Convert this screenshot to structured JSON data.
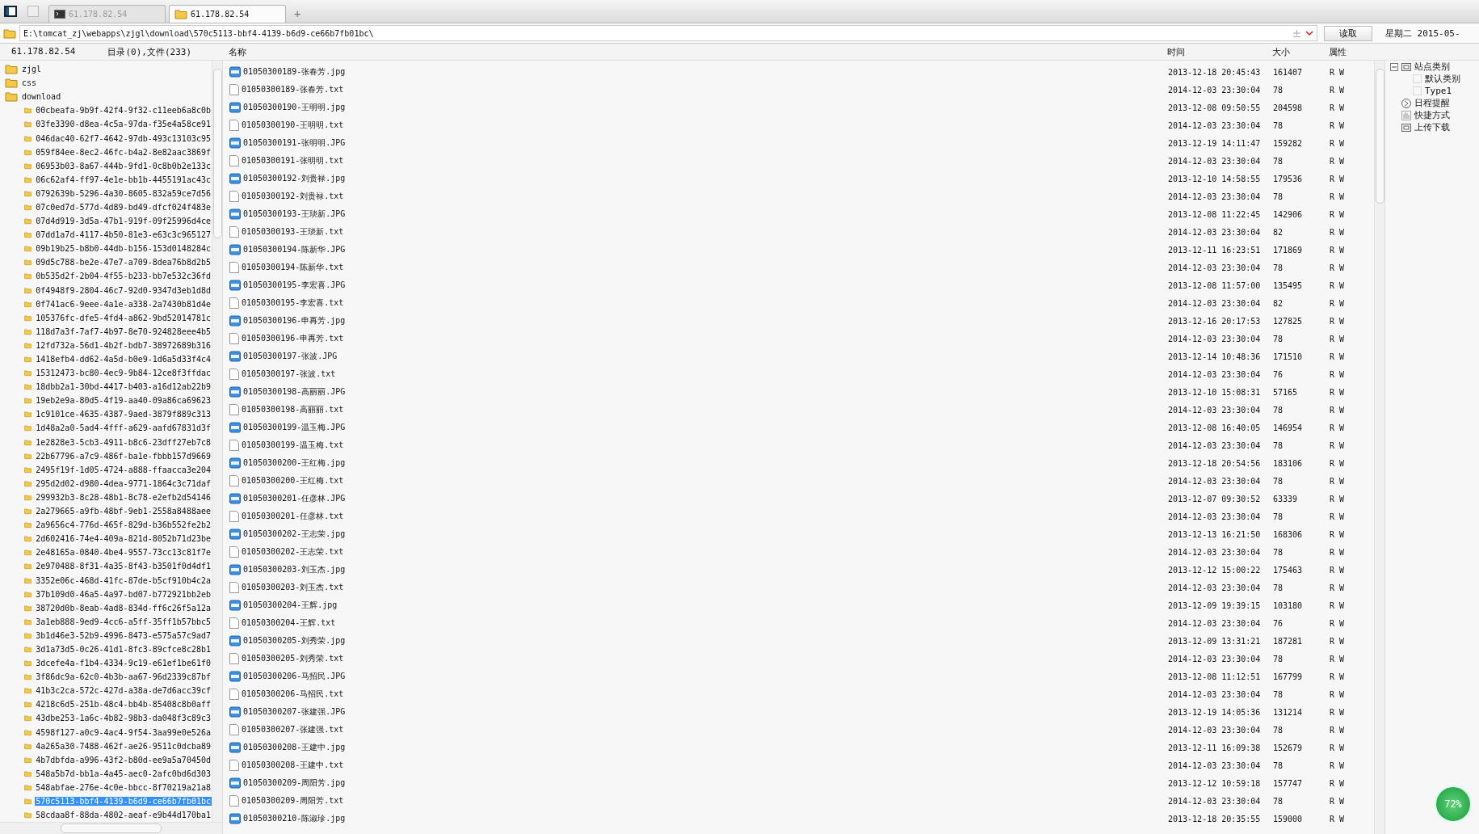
{
  "tabs": [
    {
      "label": "61.178.82.54",
      "kind": "terminal",
      "selected": false
    },
    {
      "label": "61.178.82.54",
      "kind": "folder",
      "selected": true
    }
  ],
  "new_tab": "+",
  "address": {
    "value": "E:\\tomcat_zj\\webapps\\zjgl\\download\\570c5113-bbf4-4139-b6d9-ce66b7fb01bc\\",
    "read_button": "读取",
    "date": "星期二 2015-05-"
  },
  "left_header": {
    "host": "61.178.82.54",
    "summary": "目录(0),文件(233)"
  },
  "tree": [
    {
      "label": "zjgl",
      "selected": false
    },
    {
      "label": "css",
      "selected": false
    },
    {
      "label": "download",
      "selected": false,
      "children": [
        {
          "label": "00cbeafa-9b9f-42f4-9f32-c11eeb6a8c0b",
          "selected": false
        },
        {
          "label": "03fe3390-d8ea-4c5a-97da-f35e4a58ce91",
          "selected": false
        },
        {
          "label": "046dac40-62f7-4642-97db-493c13103c95",
          "selected": false
        },
        {
          "label": "059f84ee-8ec2-46fc-b4a2-8e82aac3869f",
          "selected": false
        },
        {
          "label": "06953b03-8a67-444b-9fd1-0c8b0b2e133c",
          "selected": false
        },
        {
          "label": "06c62af4-ff97-4e1e-bb1b-4455191ac43c",
          "selected": false
        },
        {
          "label": "0792639b-5296-4a30-8605-832a59ce7d56",
          "selected": false
        },
        {
          "label": "07c0ed7d-577d-4d89-bd49-dfcf024f483e",
          "selected": false
        },
        {
          "label": "07d4d919-3d5a-47b1-919f-09f25996d4ce",
          "selected": false
        },
        {
          "label": "07dd1a7d-4117-4b50-81e3-e63c3c965127",
          "selected": false
        },
        {
          "label": "09b19b25-b8b0-44db-b156-153d0148284c",
          "selected": false
        },
        {
          "label": "09d5c788-be2e-47e7-a709-8dea76b8d2b5",
          "selected": false
        },
        {
          "label": "0b535d2f-2b04-4f55-b233-bb7e532c36fd",
          "selected": false
        },
        {
          "label": "0f4948f9-2804-46c7-92d0-9347d3eb1d8d",
          "selected": false
        },
        {
          "label": "0f741ac6-9eee-4a1e-a338-2a7430b81d4e",
          "selected": false
        },
        {
          "label": "105376fc-dfe5-4fd4-a862-9bd52014781c",
          "selected": false
        },
        {
          "label": "118d7a3f-7af7-4b97-8e70-924828eee4b5",
          "selected": false
        },
        {
          "label": "12fd732a-56d1-4b2f-bdb7-38972689b316",
          "selected": false
        },
        {
          "label": "1418efb4-dd62-4a5d-b0e9-1d6a5d33f4c4",
          "selected": false
        },
        {
          "label": "15312473-bc80-4ec9-9b84-12ce8f3ffdac",
          "selected": false
        },
        {
          "label": "18dbb2a1-30bd-4417-b403-a16d12ab22b9",
          "selected": false
        },
        {
          "label": "19eb2e9a-80d5-4f19-aa40-09a86ca69623",
          "selected": false
        },
        {
          "label": "1c9101ce-4635-4387-9aed-3879f889c313",
          "selected": false
        },
        {
          "label": "1d48a2a0-5ad4-4fff-a629-aafd67831d3f",
          "selected": false
        },
        {
          "label": "1e2828e3-5cb3-4911-b8c6-23dff27eb7c8",
          "selected": false
        },
        {
          "label": "22b67796-a7c9-486f-ba1e-fbbb157d9669",
          "selected": false
        },
        {
          "label": "2495f19f-1d05-4724-a888-ffaacca3e204",
          "selected": false
        },
        {
          "label": "295d2d02-d980-4dea-9771-1864c3c71daf",
          "selected": false
        },
        {
          "label": "299932b3-8c28-48b1-8c78-e2efb2d54146",
          "selected": false
        },
        {
          "label": "2a279665-a9fb-48bf-9eb1-2558a8488aee",
          "selected": false
        },
        {
          "label": "2a9656c4-776d-465f-829d-b36b552fe2b2",
          "selected": false
        },
        {
          "label": "2d602416-74e4-409a-821d-8052b71d23be",
          "selected": false
        },
        {
          "label": "2e48165a-0840-4be4-9557-73cc13c81f7e",
          "selected": false
        },
        {
          "label": "2e970488-8f31-4a35-8f43-b3501f0d4df1",
          "selected": false
        },
        {
          "label": "3352e06c-468d-41fc-87de-b5cf910b4c2a",
          "selected": false
        },
        {
          "label": "37b109d0-46a5-4a97-bd07-b772921bb2eb",
          "selected": false
        },
        {
          "label": "38720d0b-8eab-4ad8-834d-ff6c26f5a12a",
          "selected": false
        },
        {
          "label": "3a1eb888-9ed9-4cc6-a5ff-35ff1b57bbc5",
          "selected": false
        },
        {
          "label": "3b1d46e3-52b9-4996-8473-e575a57c9ad7",
          "selected": false
        },
        {
          "label": "3d1a73d5-0c26-41d1-8fc3-89cfce8c28b1",
          "selected": false
        },
        {
          "label": "3dcefe4a-f1b4-4334-9c19-e61ef1be61f0",
          "selected": false
        },
        {
          "label": "3f86dc9a-62c0-4b3b-aa67-96d2339c87bf",
          "selected": false
        },
        {
          "label": "41b3c2ca-572c-427d-a38a-de7d6acc39cf",
          "selected": false
        },
        {
          "label": "4218c6d5-251b-48c4-bb4b-85408c8b0aff",
          "selected": false
        },
        {
          "label": "43dbe253-1a6c-4b82-98b3-da048f3c89c3",
          "selected": false
        },
        {
          "label": "4598f127-a0c9-4ac4-9f54-3aa99e0e526a",
          "selected": false
        },
        {
          "label": "4a265a30-7488-462f-ae26-9511c0dcba89",
          "selected": false
        },
        {
          "label": "4b7dbfda-a996-43f2-b80d-ee9a5a70450d",
          "selected": false
        },
        {
          "label": "548a5b7d-bb1a-4a45-aec0-2afc0bd6d303",
          "selected": false
        },
        {
          "label": "548abfae-276e-4c0e-bbcc-8f70219a21a8",
          "selected": false
        },
        {
          "label": "570c5113-bbf4-4139-b6d9-ce66b7fb01bc",
          "selected": true
        },
        {
          "label": "58cdaa8f-88da-4802-aeaf-e9b44d170ba1",
          "selected": false
        }
      ]
    }
  ],
  "columns": [
    "名称",
    "时间",
    "大小",
    "属性"
  ],
  "files": [
    {
      "kind": "jpg",
      "name": "01050300189-张春芳.jpg",
      "time": "2013-12-18 20:45:43",
      "size": "161407",
      "attr": "R W"
    },
    {
      "kind": "txt",
      "name": "01050300189-张春芳.txt",
      "time": "2014-12-03 23:30:04",
      "size": "78",
      "attr": "R W"
    },
    {
      "kind": "jpg",
      "name": "01050300190-王明明.jpg",
      "time": "2013-12-08 09:50:55",
      "size": "204598",
      "attr": "R W"
    },
    {
      "kind": "txt",
      "name": "01050300190-王明明.txt",
      "time": "2014-12-03 23:30:04",
      "size": "78",
      "attr": "R W"
    },
    {
      "kind": "jpg",
      "name": "01050300191-张明明.JPG",
      "time": "2013-12-19 14:11:47",
      "size": "159282",
      "attr": "R W"
    },
    {
      "kind": "txt",
      "name": "01050300191-张明明.txt",
      "time": "2014-12-03 23:30:04",
      "size": "78",
      "attr": "R W"
    },
    {
      "kind": "jpg",
      "name": "01050300192-刘贵禄.jpg",
      "time": "2013-12-10 14:58:55",
      "size": "179536",
      "attr": "R W"
    },
    {
      "kind": "txt",
      "name": "01050300192-刘贵禄.txt",
      "time": "2014-12-03 23:30:04",
      "size": "78",
      "attr": "R W"
    },
    {
      "kind": "jpg",
      "name": "01050300193-王琰新.JPG",
      "time": "2013-12-08 11:22:45",
      "size": "142906",
      "attr": "R W"
    },
    {
      "kind": "txt",
      "name": "01050300193-王琰新.txt",
      "time": "2014-12-03 23:30:04",
      "size": "82",
      "attr": "R W"
    },
    {
      "kind": "jpg",
      "name": "01050300194-陈新华.JPG",
      "time": "2013-12-11 16:23:51",
      "size": "171869",
      "attr": "R W"
    },
    {
      "kind": "txt",
      "name": "01050300194-陈新华.txt",
      "time": "2014-12-03 23:30:04",
      "size": "78",
      "attr": "R W"
    },
    {
      "kind": "jpg",
      "name": "01050300195-李宏喜.JPG",
      "time": "2013-12-08 11:57:00",
      "size": "135495",
      "attr": "R W"
    },
    {
      "kind": "txt",
      "name": "01050300195-李宏喜.txt",
      "time": "2014-12-03 23:30:04",
      "size": "82",
      "attr": "R W"
    },
    {
      "kind": "jpg",
      "name": "01050300196-申再芳.jpg",
      "time": "2013-12-16 20:17:53",
      "size": "127825",
      "attr": "R W"
    },
    {
      "kind": "txt",
      "name": "01050300196-申再芳.txt",
      "time": "2014-12-03 23:30:04",
      "size": "78",
      "attr": "R W"
    },
    {
      "kind": "jpg",
      "name": "01050300197-张波.JPG",
      "time": "2013-12-14 10:48:36",
      "size": "171510",
      "attr": "R W"
    },
    {
      "kind": "txt",
      "name": "01050300197-张波.txt",
      "time": "2014-12-03 23:30:04",
      "size": "76",
      "attr": "R W"
    },
    {
      "kind": "jpg",
      "name": "01050300198-高丽丽.JPG",
      "time": "2013-12-10 15:08:31",
      "size": "57165",
      "attr": "R W"
    },
    {
      "kind": "txt",
      "name": "01050300198-高丽丽.txt",
      "time": "2014-12-03 23:30:04",
      "size": "78",
      "attr": "R W"
    },
    {
      "kind": "jpg",
      "name": "01050300199-温玉梅.JPG",
      "time": "2013-12-08 16:40:05",
      "size": "146954",
      "attr": "R W"
    },
    {
      "kind": "txt",
      "name": "01050300199-温玉梅.txt",
      "time": "2014-12-03 23:30:04",
      "size": "78",
      "attr": "R W"
    },
    {
      "kind": "jpg",
      "name": "01050300200-王红梅.jpg",
      "time": "2013-12-18 20:54:56",
      "size": "183106",
      "attr": "R W"
    },
    {
      "kind": "txt",
      "name": "01050300200-王红梅.txt",
      "time": "2014-12-03 23:30:04",
      "size": "78",
      "attr": "R W"
    },
    {
      "kind": "jpg",
      "name": "01050300201-任彦林.JPG",
      "time": "2013-12-07 09:30:52",
      "size": "63339",
      "attr": "R W"
    },
    {
      "kind": "txt",
      "name": "01050300201-任彦林.txt",
      "time": "2014-12-03 23:30:04",
      "size": "78",
      "attr": "R W"
    },
    {
      "kind": "jpg",
      "name": "01050300202-王志荣.jpg",
      "time": "2013-12-13 16:21:50",
      "size": "168306",
      "attr": "R W"
    },
    {
      "kind": "txt",
      "name": "01050300202-王志荣.txt",
      "time": "2014-12-03 23:30:04",
      "size": "78",
      "attr": "R W"
    },
    {
      "kind": "jpg",
      "name": "01050300203-刘玉杰.jpg",
      "time": "2013-12-12 15:00:22",
      "size": "175463",
      "attr": "R W"
    },
    {
      "kind": "txt",
      "name": "01050300203-刘玉杰.txt",
      "time": "2014-12-03 23:30:04",
      "size": "78",
      "attr": "R W"
    },
    {
      "kind": "jpg",
      "name": "01050300204-王辉.jpg",
      "time": "2013-12-09 19:39:15",
      "size": "103180",
      "attr": "R W"
    },
    {
      "kind": "txt",
      "name": "01050300204-王辉.txt",
      "time": "2014-12-03 23:30:04",
      "size": "76",
      "attr": "R W"
    },
    {
      "kind": "jpg",
      "name": "01050300205-刘秀荣.jpg",
      "time": "2013-12-09 13:31:21",
      "size": "187281",
      "attr": "R W"
    },
    {
      "kind": "txt",
      "name": "01050300205-刘秀荣.txt",
      "time": "2014-12-03 23:30:04",
      "size": "78",
      "attr": "R W"
    },
    {
      "kind": "jpg",
      "name": "01050300206-马招民.JPG",
      "time": "2013-12-08 11:12:51",
      "size": "167799",
      "attr": "R W"
    },
    {
      "kind": "txt",
      "name": "01050300206-马招民.txt",
      "time": "2014-12-03 23:30:04",
      "size": "78",
      "attr": "R W"
    },
    {
      "kind": "jpg",
      "name": "01050300207-张建强.JPG",
      "time": "2013-12-19 14:05:36",
      "size": "131214",
      "attr": "R W"
    },
    {
      "kind": "txt",
      "name": "01050300207-张建强.txt",
      "time": "2014-12-03 23:30:04",
      "size": "78",
      "attr": "R W"
    },
    {
      "kind": "jpg",
      "name": "01050300208-王建中.jpg",
      "time": "2013-12-11 16:09:38",
      "size": "152679",
      "attr": "R W"
    },
    {
      "kind": "txt",
      "name": "01050300208-王建中.txt",
      "time": "2014-12-03 23:30:04",
      "size": "78",
      "attr": "R W"
    },
    {
      "kind": "jpg",
      "name": "01050300209-周阳芳.jpg",
      "time": "2013-12-12 10:59:18",
      "size": "157747",
      "attr": "R W"
    },
    {
      "kind": "txt",
      "name": "01050300209-周阳芳.txt",
      "time": "2014-12-03 23:30:04",
      "size": "78",
      "attr": "R W"
    },
    {
      "kind": "jpg",
      "name": "01050300210-陈淑珍.jpg",
      "time": "2013-12-18 20:35:55",
      "size": "159000",
      "attr": "R W"
    }
  ],
  "side_tree": [
    {
      "label": "站点类别",
      "kind": "category",
      "expanded": true,
      "children": [
        {
          "label": "默认类别",
          "kind": "placeholder"
        },
        {
          "label": "Type1",
          "kind": "placeholder"
        }
      ]
    },
    {
      "label": "日程提醒",
      "kind": "schedule"
    },
    {
      "label": "快捷方式",
      "kind": "shortcut"
    },
    {
      "label": "上传下载",
      "kind": "category"
    }
  ],
  "progress_badge": "72%"
}
